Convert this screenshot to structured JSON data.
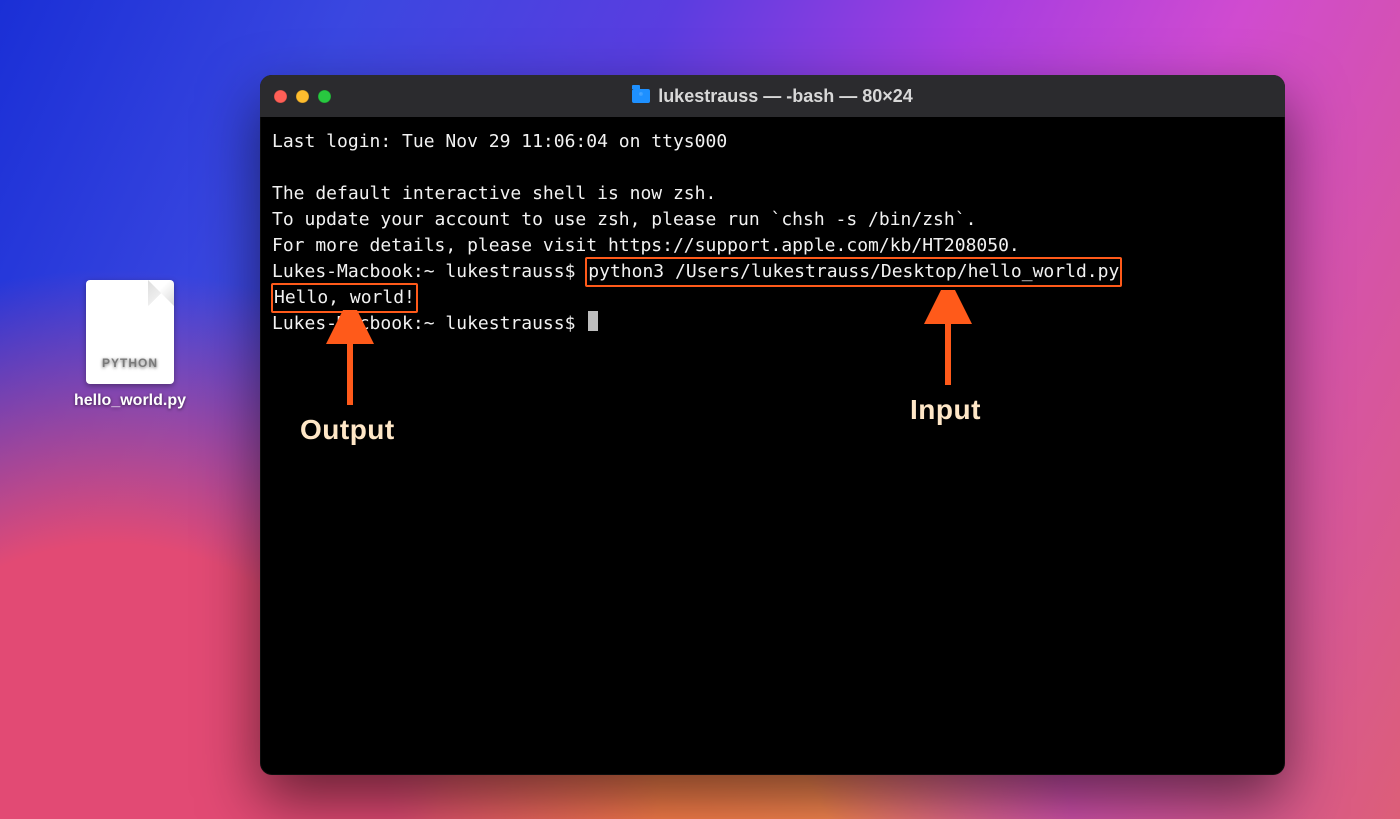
{
  "desktop": {
    "file": {
      "tag": "PYTHON",
      "name": "hello_world.py"
    }
  },
  "terminal": {
    "title": "lukestrauss — -bash — 80×24",
    "lines": {
      "last_login": "Last login: Tue Nov 29 11:06:04 on ttys000",
      "blank": " ",
      "zsh1": "The default interactive shell is now zsh.",
      "zsh2": "To update your account to use zsh, please run `chsh -s /bin/zsh`.",
      "zsh3": "For more details, please visit https://support.apple.com/kb/HT208050.",
      "prompt1_lead": "[",
      "prompt1_host": "Lukes-Macbook:~ lukestrauss$ ",
      "command": "python3 /Users/lukestrauss/Desktop/hello_world.py",
      "prompt1_trail": "   ]",
      "output": "Hello, world!",
      "prompt2_lead": "[",
      "prompt2": "Lukes-Macbook:~ lukestrauss$ "
    }
  },
  "annotations": {
    "output_label": "Output",
    "input_label": "Input"
  },
  "colors": {
    "highlight": "#ff5a1a",
    "annotation_text": "#ffe7c7"
  }
}
